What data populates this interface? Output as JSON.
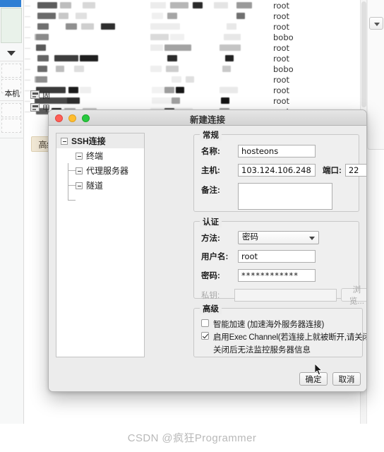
{
  "background": {
    "left_rail": {
      "local_label": "本机"
    },
    "pro_badge": "高级版",
    "user_column": [
      "root",
      "root",
      "root",
      "bobo",
      "root",
      "root",
      "bobo",
      "root",
      "root",
      "root",
      "root"
    ],
    "mosaic_note": "blurred server list rows"
  },
  "dialog": {
    "title": "新建连接",
    "window_controls": {
      "close": "close-button",
      "minimize": "minimize-button",
      "zoom": "zoom-button"
    },
    "tree": {
      "root": "SSH连接",
      "children": [
        "终端",
        "代理服务器",
        "隧道"
      ]
    },
    "general": {
      "legend": "常规",
      "name_label": "名称:",
      "name_value": "hosteons",
      "host_label": "主机:",
      "host_value": "103.124.106.248",
      "port_label": "端口:",
      "port_value": "22",
      "note_label": "备注:",
      "note_value": ""
    },
    "auth": {
      "legend": "认证",
      "method_label": "方法:",
      "method_value": "密码",
      "username_label": "用户名:",
      "username_value": "root",
      "password_label": "密码:",
      "password_value": "************",
      "privatekey_label": "私钥:",
      "privatekey_value": "",
      "browse_button": "浏览..."
    },
    "advanced": {
      "legend": "高级",
      "smart_accel_label": "智能加速 (加速海外服务器连接)",
      "smart_accel_checked": false,
      "exec_channel_label": "启用Exec Channel(若连接上就被断开,请关闭该项,比如跳板机)",
      "exec_channel_checked": true,
      "exec_channel_note": "关闭后无法监控服务器信息"
    },
    "footer": {
      "ok": "确定",
      "cancel": "取消"
    }
  },
  "watermark": "CSDN @疯狂Programmer"
}
